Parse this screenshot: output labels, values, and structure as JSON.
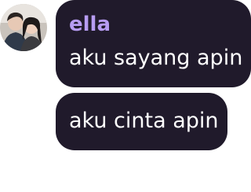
{
  "chat": {
    "messages": [
      {
        "author": "ella",
        "text": "aku sayang apin"
      },
      {
        "text": "aku cinta apin"
      }
    ],
    "colors": {
      "bubble": "#201a2b",
      "author_name": "#b79cf2",
      "text": "#ffffff"
    },
    "avatar_icon": "couple-photo-avatar"
  }
}
